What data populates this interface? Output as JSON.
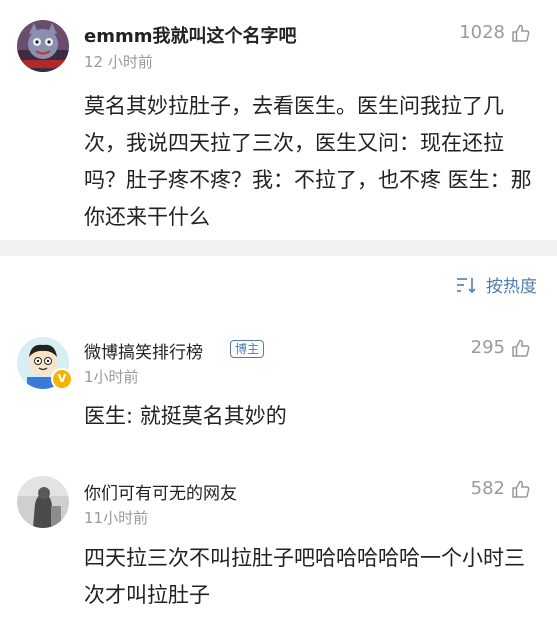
{
  "post": {
    "username": "emmm我就叫这个名字吧",
    "time": "12 小时前",
    "likes": "1028",
    "text": "莫名其妙拉肚子，去看医生。医生问我拉了几次，我说四天拉了三次，医生又问：现在还拉吗？肚子疼不疼？我：不拉了，也不疼 医生：那你还来干什么"
  },
  "sort": {
    "label": "按热度",
    "icon": "sort-icon"
  },
  "comments": [
    {
      "username": "微博搞笑排行榜",
      "badge": "博主",
      "time": "1小时前",
      "likes": "295",
      "text": "医生: 就挺莫名其妙的"
    },
    {
      "username": "你们可有可无的网友",
      "time": "11小时前",
      "likes": "582",
      "text": "四天拉三次不叫拉肚子吧哈哈哈哈哈一个小时三次才叫拉肚子"
    }
  ],
  "colors": {
    "accent": "#507daf",
    "muted": "#9a9a9a",
    "divider": "#f2f2f2",
    "verified": "#f4b400"
  }
}
